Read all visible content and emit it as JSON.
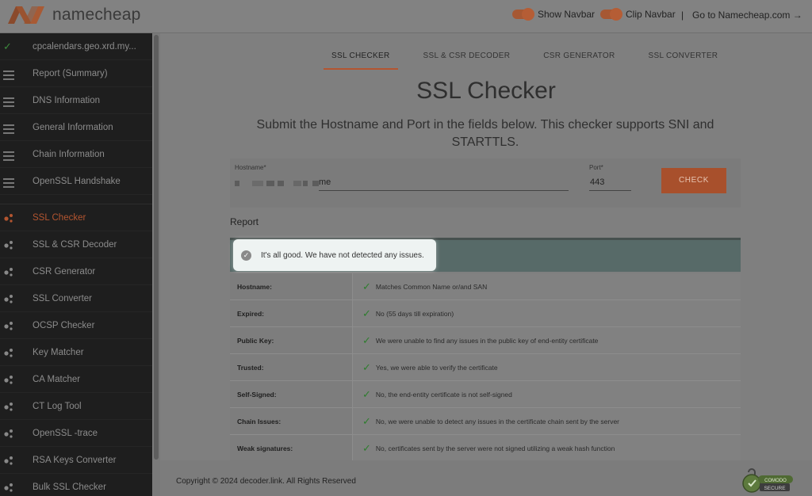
{
  "header": {
    "logo_text": "namecheap",
    "show_navbar_label": "Show Navbar",
    "clip_navbar_label": "Clip Navbar",
    "separator": "|",
    "goto_label": "Go to Namecheap.com →"
  },
  "sidebar": {
    "items": [
      {
        "label": "cpcalendars.geo.xrd.my..."
      },
      {
        "label": "Report (Summary)"
      },
      {
        "label": "DNS Information"
      },
      {
        "label": "General Information"
      },
      {
        "label": "Chain Information"
      },
      {
        "label": "OpenSSL Handshake"
      },
      {
        "label": "SSL Checker"
      },
      {
        "label": "SSL & CSR Decoder"
      },
      {
        "label": "CSR Generator"
      },
      {
        "label": "SSL Converter"
      },
      {
        "label": "OCSP Checker"
      },
      {
        "label": "Key Matcher"
      },
      {
        "label": "CA Matcher"
      },
      {
        "label": "CT Log Tool"
      },
      {
        "label": "OpenSSL -trace"
      },
      {
        "label": "RSA Keys Converter"
      },
      {
        "label": "Bulk SSL Checker"
      }
    ]
  },
  "tabs": [
    "SSL CHECKER",
    "SSL & CSR DECODER",
    "CSR GENERATOR",
    "SSL CONVERTER"
  ],
  "main": {
    "title": "SSL Checker",
    "subtitle": "Submit the Hostname and Port in the fields below. This checker supports SNI and STARTTLS.",
    "hostname_label": "Hostname*",
    "hostname_value": "me",
    "port_label": "Port*",
    "port_value": "443",
    "check_button": "CHECK",
    "report_label": "Report",
    "ok_message": "It's all good. We have not detected any issues."
  },
  "report": [
    {
      "key": "Hostname:",
      "value": "Matches Common Name or/and SAN"
    },
    {
      "key": "Expired:",
      "value": "No (55 days till expiration)"
    },
    {
      "key": "Public Key:",
      "value": "We were unable to find any issues in the public key of end-entity certificate"
    },
    {
      "key": "Trusted:",
      "value": "Yes, we were able to verify the certificate"
    },
    {
      "key": "Self-Signed:",
      "value": "No, the end-entity certificate is not self-signed"
    },
    {
      "key": "Chain Issues:",
      "value": "No, we were unable to detect any issues in the certificate chain sent by the server"
    },
    {
      "key": "Weak signatures:",
      "value": "No, certificates sent by the server were not signed utilizing a weak hash function"
    }
  ],
  "footer": {
    "copyright": "Copyright © 2024 decoder.link. All Rights Reserved",
    "seal_top": "COMODO",
    "seal_bottom": "SECURE"
  },
  "colors": {
    "accent": "#b35530",
    "sidebar_bg": "#1e1e1e",
    "success": "#2e7d2e"
  }
}
